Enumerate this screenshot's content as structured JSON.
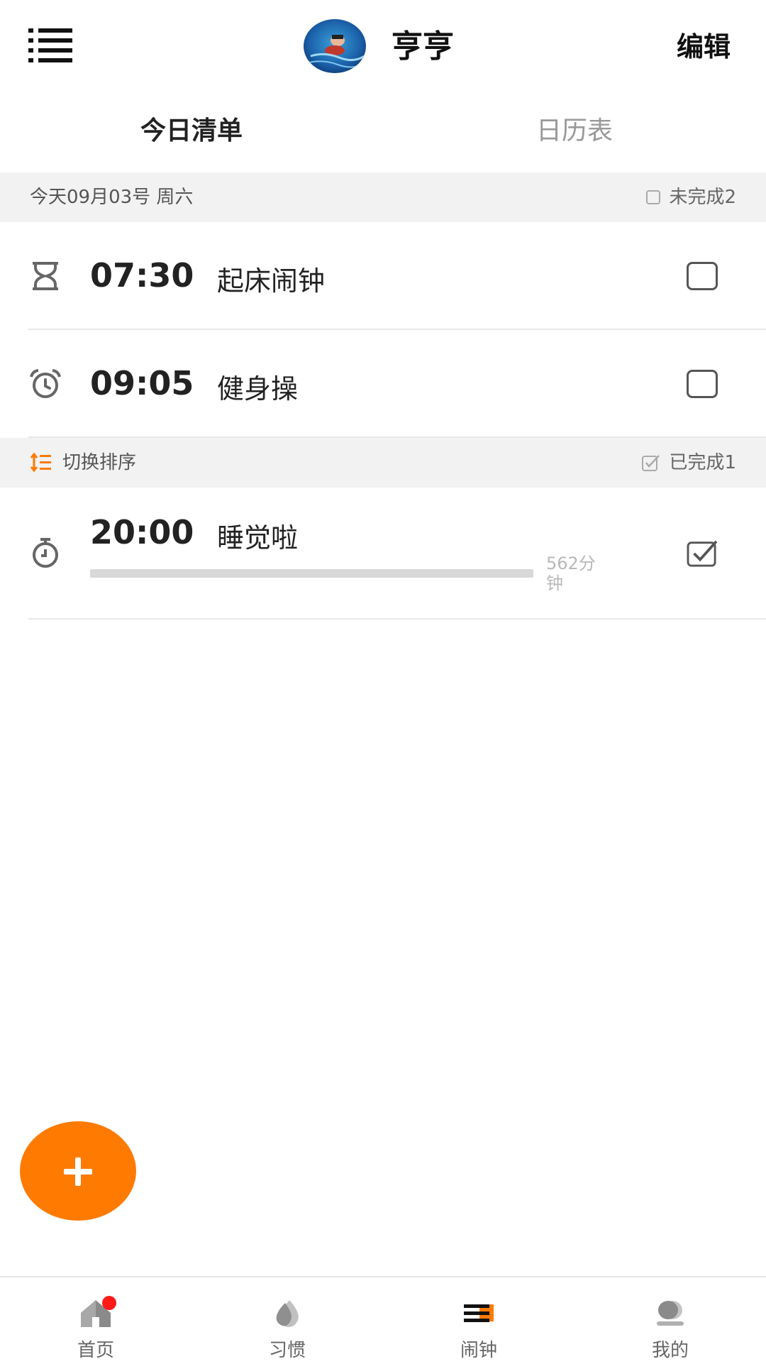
{
  "header": {
    "username": "亨亨",
    "edit_label": "编辑",
    "menu_icon": "list-menu-icon",
    "avatar_icon": "avatar-swimmer-image"
  },
  "tabs": [
    {
      "label": "今日清单",
      "active": true
    },
    {
      "label": "日历表",
      "active": false
    }
  ],
  "pending_section": {
    "date_text": "今天09月03号 周六",
    "status_label": "未完成2"
  },
  "done_section": {
    "sort_label": "切换排序",
    "status_label": "已完成1",
    "sort_icon": "sort-icon"
  },
  "alarms": [
    {
      "time": "07:30",
      "title": "起床闹钟",
      "icon": "hourglass-icon",
      "done": false
    },
    {
      "time": "09:05",
      "title": "健身操",
      "icon": "alarm-clock-icon",
      "done": false
    },
    {
      "time": "20:00",
      "title": "睡觉啦",
      "icon": "stopwatch-icon",
      "done": true,
      "remaining_label": "562分钟",
      "progress": 1.0
    }
  ],
  "fab": {
    "icon": "plus-icon"
  },
  "bottom_nav": [
    {
      "label": "首页",
      "icon": "home-icon",
      "badge": true,
      "active": false
    },
    {
      "label": "习惯",
      "icon": "drop-icon",
      "badge": false,
      "active": false
    },
    {
      "label": "闹钟",
      "icon": "alarm-list-icon",
      "badge": false,
      "active": true
    },
    {
      "label": "我的",
      "icon": "profile-icon",
      "badge": false,
      "active": false
    }
  ],
  "colors": {
    "accent": "#ff7a00",
    "section_bg": "#f2f2f2",
    "badge": "#ff1a1a"
  }
}
